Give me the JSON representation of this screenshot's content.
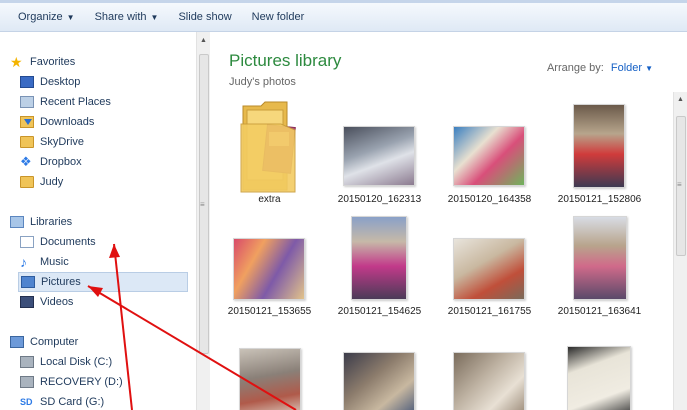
{
  "toolbar": {
    "organize": "Organize",
    "share_with": "Share with",
    "slide_show": "Slide show",
    "new_folder": "New folder"
  },
  "nav": {
    "favorites": "Favorites",
    "desktop": "Desktop",
    "recent_places": "Recent Places",
    "downloads": "Downloads",
    "skydrive": "SkyDrive",
    "dropbox": "Dropbox",
    "judy": "Judy",
    "libraries": "Libraries",
    "documents": "Documents",
    "music": "Music",
    "pictures": "Pictures",
    "videos": "Videos",
    "computer": "Computer",
    "local_disk": "Local Disk (C:)",
    "recovery": "RECOVERY (D:)",
    "sd_card": "SD Card (G:)"
  },
  "content": {
    "title": "Pictures library",
    "subtitle": "Judy's photos",
    "arrange_label": "Arrange by:",
    "arrange_value": "Folder"
  },
  "items": [
    {
      "name": "extra"
    },
    {
      "name": "20150120_162313"
    },
    {
      "name": "20150120_164358"
    },
    {
      "name": "20150121_152806"
    },
    {
      "name": "20150121_153655"
    },
    {
      "name": "20150121_154625"
    },
    {
      "name": "20150121_161755"
    },
    {
      "name": "20150121_163641"
    }
  ],
  "colors": {
    "library_title": "#2d8a3f",
    "link_blue": "#1560c6",
    "annotation_arrow": "#e01010",
    "selected_bg": "#dce8f6"
  }
}
